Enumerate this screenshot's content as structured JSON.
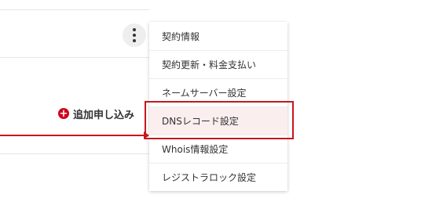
{
  "list": {
    "add_application_label": "追加申し込み"
  },
  "menu": {
    "items": [
      {
        "label": "契約情報"
      },
      {
        "label": "契約更新・料金支払い"
      },
      {
        "label": "ネームサーバー設定"
      },
      {
        "label": "DNSレコード設定"
      },
      {
        "label": "Whois情報設定"
      },
      {
        "label": "レジストラロック設定"
      }
    ]
  },
  "annotation": {
    "color": "#c8161d"
  }
}
